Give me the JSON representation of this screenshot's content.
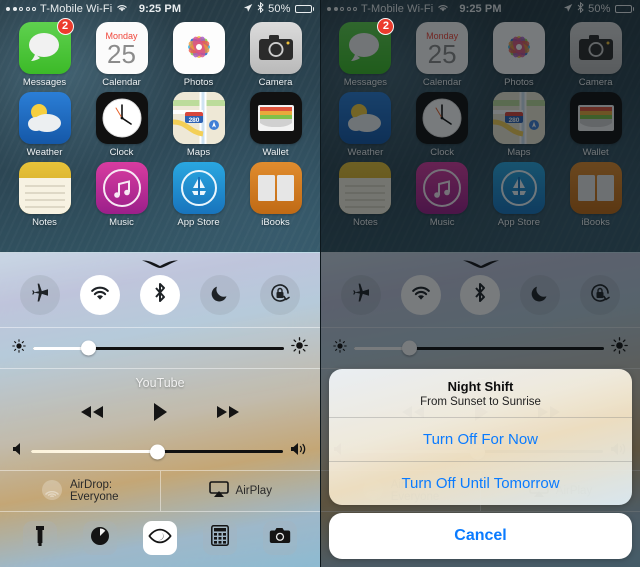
{
  "status_bar": {
    "carrier": "T-Mobile Wi-Fi",
    "signal_dots_filled": 2,
    "signal_dots_total": 5,
    "wifi_icon": "wifi-icon",
    "time": "9:25 PM",
    "location_icon": "location-arrow-icon",
    "bluetooth_icon": "bluetooth-icon",
    "battery_percent": "50%",
    "battery_level": 50
  },
  "home_screen": {
    "rows": [
      [
        {
          "label": "Messages",
          "icon": "messages-icon",
          "badge": "2"
        },
        {
          "label": "Calendar",
          "icon": "calendar-icon",
          "day_of_week": "Monday",
          "day": "25"
        },
        {
          "label": "Photos",
          "icon": "photos-icon"
        },
        {
          "label": "Camera",
          "icon": "camera-icon"
        }
      ],
      [
        {
          "label": "Weather",
          "icon": "weather-icon"
        },
        {
          "label": "Clock",
          "icon": "clock-icon"
        },
        {
          "label": "Maps",
          "icon": "maps-icon",
          "route_shield": "280"
        },
        {
          "label": "Wallet",
          "icon": "wallet-icon"
        }
      ],
      [
        {
          "label": "Notes",
          "icon": "notes-icon"
        },
        {
          "label": "Music",
          "icon": "music-icon"
        },
        {
          "label": "App Store",
          "icon": "app-store-icon"
        },
        {
          "label": "iBooks",
          "icon": "ibooks-icon"
        }
      ]
    ]
  },
  "control_center": {
    "handle_icon": "chevron-handle-icon",
    "toggles": [
      {
        "name": "airplane-mode",
        "icon": "airplane-icon",
        "state": "off"
      },
      {
        "name": "wifi",
        "icon": "wifi-icon",
        "state": "on"
      },
      {
        "name": "bluetooth",
        "icon": "bluetooth-icon",
        "state": "on"
      },
      {
        "name": "do-not-disturb",
        "icon": "moon-icon",
        "state": "off"
      },
      {
        "name": "rotation-lock",
        "icon": "rotation-lock-icon",
        "state": "off"
      }
    ],
    "brightness": {
      "label": "Brightness",
      "low_icon": "brightness-low-icon",
      "high_icon": "brightness-high-icon",
      "value": 22
    },
    "now_playing": {
      "title": "YouTube",
      "rewind_icon": "rewind-icon",
      "play_icon": "play-icon",
      "fast-forward_icon": "fast-forward-icon"
    },
    "volume": {
      "label": "Volume",
      "low_icon": "volume-low-icon",
      "high_icon": "volume-high-icon",
      "value": 50
    },
    "airdrop": {
      "icon": "airdrop-icon",
      "label": "AirDrop:",
      "value": "Everyone"
    },
    "airplay": {
      "icon": "airplay-icon",
      "label": "AirPlay"
    },
    "shortcuts": [
      {
        "name": "flashlight",
        "icon": "flashlight-icon",
        "state": "off"
      },
      {
        "name": "timer",
        "icon": "timer-icon",
        "state": "off"
      },
      {
        "name": "night-shift",
        "icon": "night-shift-eye-icon",
        "state": "on"
      },
      {
        "name": "calculator",
        "icon": "calculator-icon",
        "state": "off"
      },
      {
        "name": "camera",
        "icon": "camera-icon",
        "state": "off"
      }
    ]
  },
  "action_sheet": {
    "title": "Night Shift",
    "subtitle": "From Sunset to Sunrise",
    "options": [
      "Turn Off For Now",
      "Turn Off Until Tomorrow"
    ],
    "cancel": "Cancel",
    "accent_color": "#0a7bff"
  }
}
